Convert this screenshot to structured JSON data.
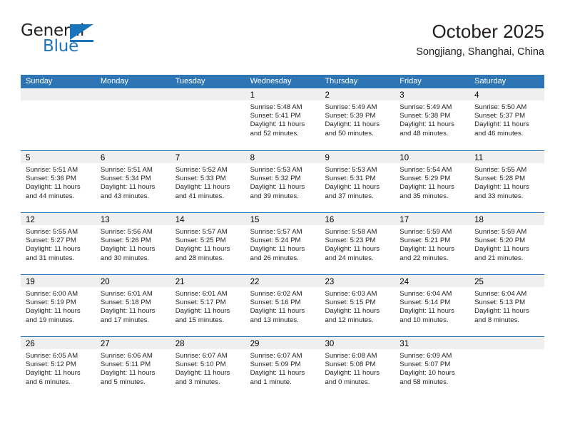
{
  "brand": {
    "name_part1": "General",
    "name_part2": "Blue",
    "logo_icon": "blue-triangle-mark"
  },
  "header": {
    "title": "October 2025",
    "subtitle": "Songjiang, Shanghai, China"
  },
  "calendar": {
    "weekday_headers": [
      "Sunday",
      "Monday",
      "Tuesday",
      "Wednesday",
      "Thursday",
      "Friday",
      "Saturday"
    ],
    "accent_color": "#2e75b6",
    "daynum_band_color": "#efefef",
    "weeks": [
      [
        {
          "day": "",
          "empty": true
        },
        {
          "day": "",
          "empty": true
        },
        {
          "day": "",
          "empty": true
        },
        {
          "day": "1",
          "sunrise": "Sunrise: 5:48 AM",
          "sunset": "Sunset: 5:41 PM",
          "daylight": "Daylight: 11 hours and 52 minutes."
        },
        {
          "day": "2",
          "sunrise": "Sunrise: 5:49 AM",
          "sunset": "Sunset: 5:39 PM",
          "daylight": "Daylight: 11 hours and 50 minutes."
        },
        {
          "day": "3",
          "sunrise": "Sunrise: 5:49 AM",
          "sunset": "Sunset: 5:38 PM",
          "daylight": "Daylight: 11 hours and 48 minutes."
        },
        {
          "day": "4",
          "sunrise": "Sunrise: 5:50 AM",
          "sunset": "Sunset: 5:37 PM",
          "daylight": "Daylight: 11 hours and 46 minutes."
        }
      ],
      [
        {
          "day": "5",
          "sunrise": "Sunrise: 5:51 AM",
          "sunset": "Sunset: 5:36 PM",
          "daylight": "Daylight: 11 hours and 44 minutes."
        },
        {
          "day": "6",
          "sunrise": "Sunrise: 5:51 AM",
          "sunset": "Sunset: 5:34 PM",
          "daylight": "Daylight: 11 hours and 43 minutes."
        },
        {
          "day": "7",
          "sunrise": "Sunrise: 5:52 AM",
          "sunset": "Sunset: 5:33 PM",
          "daylight": "Daylight: 11 hours and 41 minutes."
        },
        {
          "day": "8",
          "sunrise": "Sunrise: 5:53 AM",
          "sunset": "Sunset: 5:32 PM",
          "daylight": "Daylight: 11 hours and 39 minutes."
        },
        {
          "day": "9",
          "sunrise": "Sunrise: 5:53 AM",
          "sunset": "Sunset: 5:31 PM",
          "daylight": "Daylight: 11 hours and 37 minutes."
        },
        {
          "day": "10",
          "sunrise": "Sunrise: 5:54 AM",
          "sunset": "Sunset: 5:29 PM",
          "daylight": "Daylight: 11 hours and 35 minutes."
        },
        {
          "day": "11",
          "sunrise": "Sunrise: 5:55 AM",
          "sunset": "Sunset: 5:28 PM",
          "daylight": "Daylight: 11 hours and 33 minutes."
        }
      ],
      [
        {
          "day": "12",
          "sunrise": "Sunrise: 5:55 AM",
          "sunset": "Sunset: 5:27 PM",
          "daylight": "Daylight: 11 hours and 31 minutes."
        },
        {
          "day": "13",
          "sunrise": "Sunrise: 5:56 AM",
          "sunset": "Sunset: 5:26 PM",
          "daylight": "Daylight: 11 hours and 30 minutes."
        },
        {
          "day": "14",
          "sunrise": "Sunrise: 5:57 AM",
          "sunset": "Sunset: 5:25 PM",
          "daylight": "Daylight: 11 hours and 28 minutes."
        },
        {
          "day": "15",
          "sunrise": "Sunrise: 5:57 AM",
          "sunset": "Sunset: 5:24 PM",
          "daylight": "Daylight: 11 hours and 26 minutes."
        },
        {
          "day": "16",
          "sunrise": "Sunrise: 5:58 AM",
          "sunset": "Sunset: 5:23 PM",
          "daylight": "Daylight: 11 hours and 24 minutes."
        },
        {
          "day": "17",
          "sunrise": "Sunrise: 5:59 AM",
          "sunset": "Sunset: 5:21 PM",
          "daylight": "Daylight: 11 hours and 22 minutes."
        },
        {
          "day": "18",
          "sunrise": "Sunrise: 5:59 AM",
          "sunset": "Sunset: 5:20 PM",
          "daylight": "Daylight: 11 hours and 21 minutes."
        }
      ],
      [
        {
          "day": "19",
          "sunrise": "Sunrise: 6:00 AM",
          "sunset": "Sunset: 5:19 PM",
          "daylight": "Daylight: 11 hours and 19 minutes."
        },
        {
          "day": "20",
          "sunrise": "Sunrise: 6:01 AM",
          "sunset": "Sunset: 5:18 PM",
          "daylight": "Daylight: 11 hours and 17 minutes."
        },
        {
          "day": "21",
          "sunrise": "Sunrise: 6:01 AM",
          "sunset": "Sunset: 5:17 PM",
          "daylight": "Daylight: 11 hours and 15 minutes."
        },
        {
          "day": "22",
          "sunrise": "Sunrise: 6:02 AM",
          "sunset": "Sunset: 5:16 PM",
          "daylight": "Daylight: 11 hours and 13 minutes."
        },
        {
          "day": "23",
          "sunrise": "Sunrise: 6:03 AM",
          "sunset": "Sunset: 5:15 PM",
          "daylight": "Daylight: 11 hours and 12 minutes."
        },
        {
          "day": "24",
          "sunrise": "Sunrise: 6:04 AM",
          "sunset": "Sunset: 5:14 PM",
          "daylight": "Daylight: 11 hours and 10 minutes."
        },
        {
          "day": "25",
          "sunrise": "Sunrise: 6:04 AM",
          "sunset": "Sunset: 5:13 PM",
          "daylight": "Daylight: 11 hours and 8 minutes."
        }
      ],
      [
        {
          "day": "26",
          "sunrise": "Sunrise: 6:05 AM",
          "sunset": "Sunset: 5:12 PM",
          "daylight": "Daylight: 11 hours and 6 minutes."
        },
        {
          "day": "27",
          "sunrise": "Sunrise: 6:06 AM",
          "sunset": "Sunset: 5:11 PM",
          "daylight": "Daylight: 11 hours and 5 minutes."
        },
        {
          "day": "28",
          "sunrise": "Sunrise: 6:07 AM",
          "sunset": "Sunset: 5:10 PM",
          "daylight": "Daylight: 11 hours and 3 minutes."
        },
        {
          "day": "29",
          "sunrise": "Sunrise: 6:07 AM",
          "sunset": "Sunset: 5:09 PM",
          "daylight": "Daylight: 11 hours and 1 minute."
        },
        {
          "day": "30",
          "sunrise": "Sunrise: 6:08 AM",
          "sunset": "Sunset: 5:08 PM",
          "daylight": "Daylight: 11 hours and 0 minutes."
        },
        {
          "day": "31",
          "sunrise": "Sunrise: 6:09 AM",
          "sunset": "Sunset: 5:07 PM",
          "daylight": "Daylight: 10 hours and 58 minutes."
        },
        {
          "day": "",
          "empty": true
        }
      ]
    ]
  }
}
